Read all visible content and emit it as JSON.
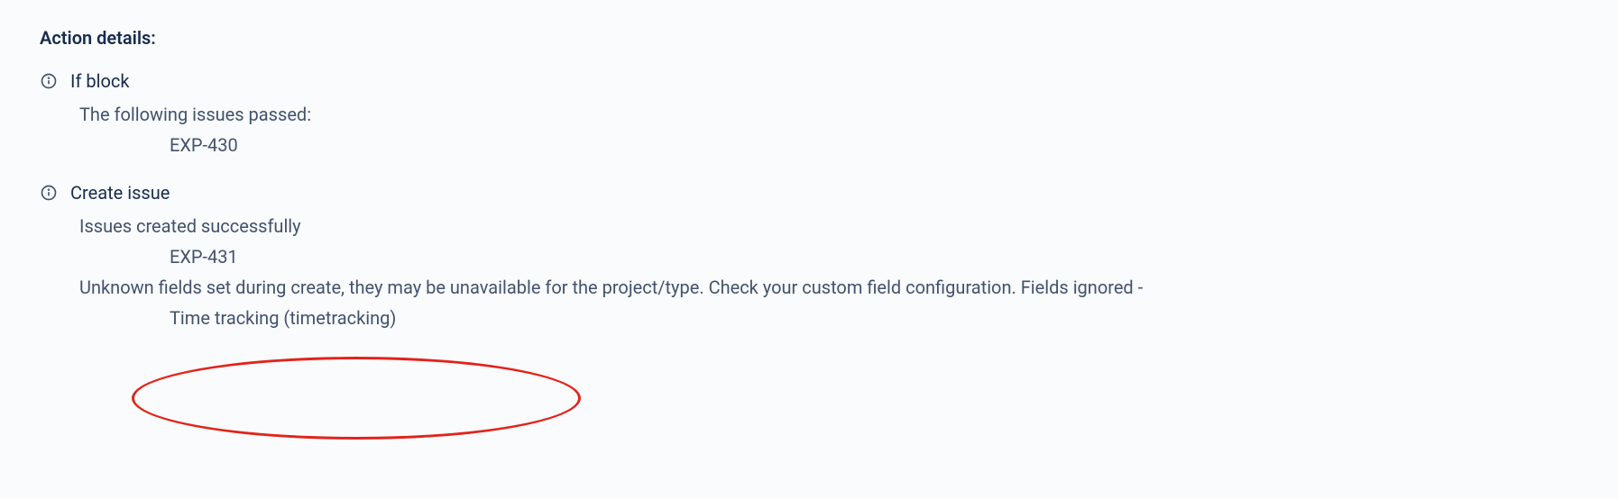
{
  "section": {
    "title": "Action details:"
  },
  "blocks": [
    {
      "title": "If block",
      "lines": [
        "The following issues passed:"
      ],
      "indented": [
        "EXP-430"
      ]
    },
    {
      "title": "Create issue",
      "lines": [
        "Issues created successfully"
      ],
      "indented": [
        "EXP-431"
      ],
      "extra_lines": [
        "Unknown fields set during create, they may be unavailable for the project/type. Check your custom field configuration. Fields ignored -"
      ],
      "extra_indented": [
        "Time tracking (timetracking)"
      ]
    }
  ],
  "annotation": {
    "ellipse": true
  }
}
